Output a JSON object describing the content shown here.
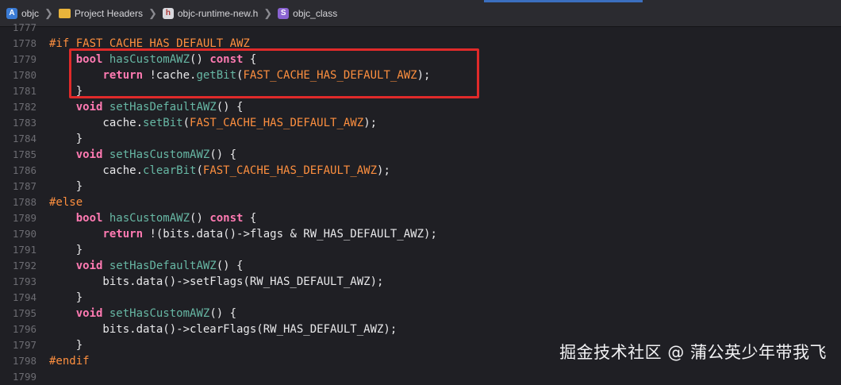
{
  "breadcrumb": {
    "items": [
      {
        "label": "objc",
        "icon": "xcode-project-icon"
      },
      {
        "label": "Project Headers",
        "icon": "folder-icon"
      },
      {
        "label": "objc-runtime-new.h",
        "icon": "header-file-icon",
        "glyph": "h"
      },
      {
        "label": "objc_class",
        "icon": "struct-icon",
        "glyph": "S"
      }
    ]
  },
  "editor": {
    "lines": [
      {
        "num": "1777",
        "tokens": []
      },
      {
        "num": "1778",
        "tokens": [
          {
            "t": "#if ",
            "c": "pp"
          },
          {
            "t": "FAST_CACHE_HAS_DEFAULT_AWZ",
            "c": "mac"
          }
        ]
      },
      {
        "num": "1779",
        "tokens": [
          {
            "t": "    ",
            "c": "plain"
          },
          {
            "t": "bool",
            "c": "kw"
          },
          {
            "t": " ",
            "c": "plain"
          },
          {
            "t": "hasCustomAWZ",
            "c": "fn"
          },
          {
            "t": "() ",
            "c": "plain"
          },
          {
            "t": "const",
            "c": "kw"
          },
          {
            "t": " {",
            "c": "plain"
          }
        ]
      },
      {
        "num": "1780",
        "tokens": [
          {
            "t": "        ",
            "c": "plain"
          },
          {
            "t": "return",
            "c": "kw"
          },
          {
            "t": " !cache.",
            "c": "plain"
          },
          {
            "t": "getBit",
            "c": "fn"
          },
          {
            "t": "(",
            "c": "plain"
          },
          {
            "t": "FAST_CACHE_HAS_DEFAULT_AWZ",
            "c": "mac"
          },
          {
            "t": ");",
            "c": "plain"
          }
        ]
      },
      {
        "num": "1781",
        "tokens": [
          {
            "t": "    }",
            "c": "plain"
          }
        ]
      },
      {
        "num": "1782",
        "tokens": [
          {
            "t": "    ",
            "c": "plain"
          },
          {
            "t": "void",
            "c": "kw"
          },
          {
            "t": " ",
            "c": "plain"
          },
          {
            "t": "setHasDefaultAWZ",
            "c": "fn"
          },
          {
            "t": "() {",
            "c": "plain"
          }
        ]
      },
      {
        "num": "1783",
        "tokens": [
          {
            "t": "        cache.",
            "c": "plain"
          },
          {
            "t": "setBit",
            "c": "fn"
          },
          {
            "t": "(",
            "c": "plain"
          },
          {
            "t": "FAST_CACHE_HAS_DEFAULT_AWZ",
            "c": "mac"
          },
          {
            "t": ");",
            "c": "plain"
          }
        ]
      },
      {
        "num": "1784",
        "tokens": [
          {
            "t": "    }",
            "c": "plain"
          }
        ]
      },
      {
        "num": "1785",
        "tokens": [
          {
            "t": "    ",
            "c": "plain"
          },
          {
            "t": "void",
            "c": "kw"
          },
          {
            "t": " ",
            "c": "plain"
          },
          {
            "t": "setHasCustomAWZ",
            "c": "fn"
          },
          {
            "t": "() {",
            "c": "plain"
          }
        ]
      },
      {
        "num": "1786",
        "tokens": [
          {
            "t": "        cache.",
            "c": "plain"
          },
          {
            "t": "clearBit",
            "c": "fn"
          },
          {
            "t": "(",
            "c": "plain"
          },
          {
            "t": "FAST_CACHE_HAS_DEFAULT_AWZ",
            "c": "mac"
          },
          {
            "t": ");",
            "c": "plain"
          }
        ]
      },
      {
        "num": "1787",
        "tokens": [
          {
            "t": "    }",
            "c": "plain"
          }
        ]
      },
      {
        "num": "1788",
        "tokens": [
          {
            "t": "#else",
            "c": "pp"
          }
        ]
      },
      {
        "num": "1789",
        "tokens": [
          {
            "t": "    ",
            "c": "plain"
          },
          {
            "t": "bool",
            "c": "kw"
          },
          {
            "t": " ",
            "c": "plain"
          },
          {
            "t": "hasCustomAWZ",
            "c": "fn"
          },
          {
            "t": "() ",
            "c": "plain"
          },
          {
            "t": "const",
            "c": "kw"
          },
          {
            "t": " {",
            "c": "plain"
          }
        ]
      },
      {
        "num": "1790",
        "tokens": [
          {
            "t": "        ",
            "c": "plain"
          },
          {
            "t": "return",
            "c": "kw"
          },
          {
            "t": " !(bits.data()->flags & RW_HAS_DEFAULT_AWZ);",
            "c": "plain"
          }
        ]
      },
      {
        "num": "1791",
        "tokens": [
          {
            "t": "    }",
            "c": "plain"
          }
        ]
      },
      {
        "num": "1792",
        "tokens": [
          {
            "t": "    ",
            "c": "plain"
          },
          {
            "t": "void",
            "c": "kw"
          },
          {
            "t": " ",
            "c": "plain"
          },
          {
            "t": "setHasDefaultAWZ",
            "c": "fn"
          },
          {
            "t": "() {",
            "c": "plain"
          }
        ]
      },
      {
        "num": "1793",
        "tokens": [
          {
            "t": "        bits.data()->setFlags(RW_HAS_DEFAULT_AWZ);",
            "c": "plain"
          }
        ]
      },
      {
        "num": "1794",
        "tokens": [
          {
            "t": "    }",
            "c": "plain"
          }
        ]
      },
      {
        "num": "1795",
        "tokens": [
          {
            "t": "    ",
            "c": "plain"
          },
          {
            "t": "void",
            "c": "kw"
          },
          {
            "t": " ",
            "c": "plain"
          },
          {
            "t": "setHasCustomAWZ",
            "c": "fn"
          },
          {
            "t": "() {",
            "c": "plain"
          }
        ]
      },
      {
        "num": "1796",
        "tokens": [
          {
            "t": "        bits.data()->clearFlags(RW_HAS_DEFAULT_AWZ);",
            "c": "plain"
          }
        ]
      },
      {
        "num": "1797",
        "tokens": [
          {
            "t": "    }",
            "c": "plain"
          }
        ]
      },
      {
        "num": "1798",
        "tokens": [
          {
            "t": "#endif",
            "c": "pp"
          }
        ]
      },
      {
        "num": "1799",
        "tokens": []
      }
    ],
    "highlight_color": "#e02a2a"
  },
  "watermark": "掘金技术社区 @ 蒲公英少年带我飞",
  "colors": {
    "background": "#1f1f24",
    "keyword": "#ff7ab2",
    "preprocessor": "#fd8f3f",
    "function": "#67b7a4",
    "plain": "#e8e8ea",
    "line_number": "#6c6c72"
  }
}
